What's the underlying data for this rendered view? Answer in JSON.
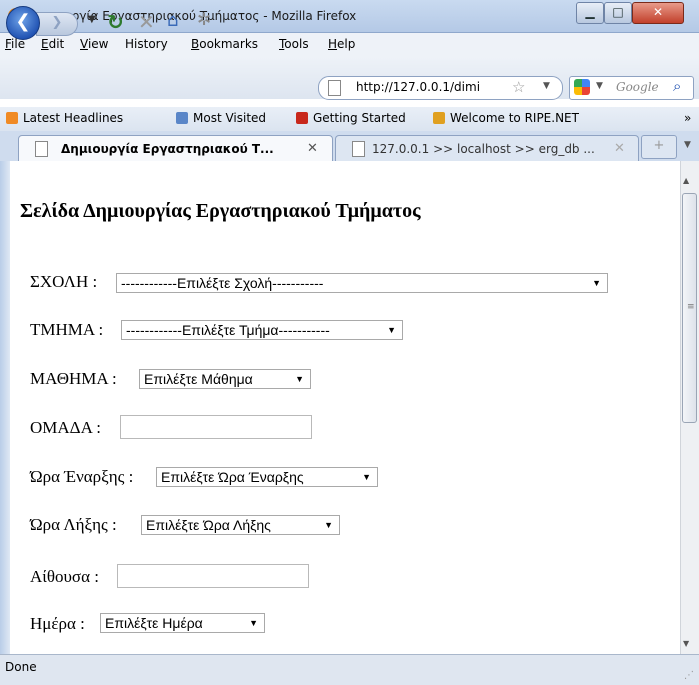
{
  "window": {
    "title": "Δημιουργία Εργαστηριακού Τμήματος - Mozilla Firefox",
    "min_label": "▁",
    "max_label": "□",
    "close_label": "✕"
  },
  "menu": [
    "File",
    "Edit",
    "View",
    "History",
    "Bookmarks",
    "Tools",
    "Help"
  ],
  "menu_underline": [
    "F",
    "E",
    "V",
    "s",
    "B",
    "T",
    "H"
  ],
  "nav": {
    "back_glyph": "❮",
    "forward_glyph": "❯",
    "url": "http://127.0.0.1/dimi",
    "search_placeholder": "Google",
    "icons": [
      "back-icon",
      "forward-icon",
      "reload-icon",
      "stop-icon",
      "home-icon",
      "gear-icon",
      "star-icon",
      "search-icon"
    ]
  },
  "bookmarks": [
    {
      "label": "Latest Headlines",
      "icon_color": "#f08a24"
    },
    {
      "label": "Most Visited",
      "icon_color": "#5a86c8"
    },
    {
      "label": "Getting Started",
      "icon_color": "#c8281c"
    },
    {
      "label": "Welcome to RIPE.NET",
      "icon_color": "#e0a020"
    }
  ],
  "bookmarks_more": "»",
  "tabs": [
    {
      "label": "Δημιουργία Εργαστηριακού Τ...",
      "close": "✕",
      "active": true
    },
    {
      "label": "127.0.0.1 >> localhost >> erg_db ...",
      "close": "✕",
      "active": false
    }
  ],
  "newtab_glyph": "+",
  "page": {
    "heading": "Σελίδα Δημιουργίας Εργαστηριακού Τμήματος",
    "fields": {
      "school": {
        "label": "ΣΧΟΛΗ :",
        "selected": "------------Επιλέξτε Σχολή-----------"
      },
      "department": {
        "label": "ΤΜΗΜΑ :",
        "selected": "------------Επιλέξτε Τμήμα-----------"
      },
      "course": {
        "label": "ΜΑΘΗΜΑ :",
        "selected": "Επιλέξτε Μάθημα"
      },
      "group": {
        "label": "ΟΜΑΔΑ :",
        "value": ""
      },
      "start_time": {
        "label": "Ώρα Έναρξης :",
        "selected": "Επιλέξτε Ώρα Έναρξης"
      },
      "end_time": {
        "label": "Ώρα Λήξης :",
        "selected": "Επιλέξτε Ώρα Λήξης"
      },
      "room": {
        "label": "Αίθουσα :",
        "value": ""
      },
      "day": {
        "label": "Ημέρα :",
        "selected": "Επιλέξτε Ημέρα"
      }
    }
  },
  "status": "Done",
  "colors": {
    "titlebar": "#c9daf0",
    "close_button": "#c2402b",
    "accent": "#1d4fb0"
  }
}
